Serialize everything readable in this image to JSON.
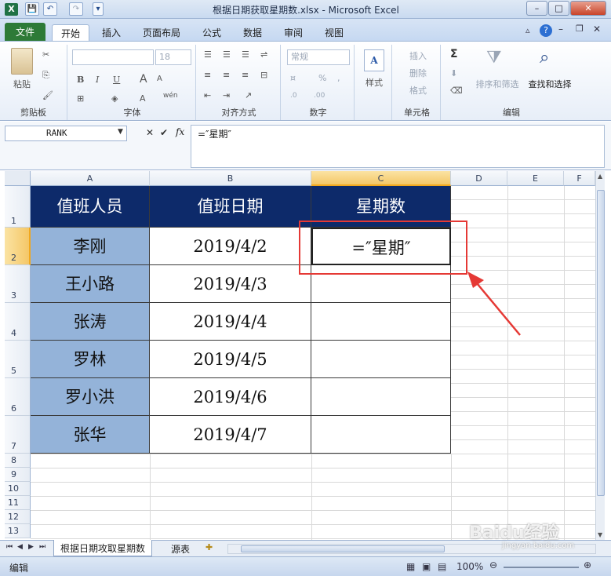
{
  "window": {
    "title": "根据日期获取星期数.xlsx - Microsoft Excel",
    "controls": {
      "minimize": "–",
      "maximize": "□",
      "close": "✕"
    }
  },
  "quick_access": {
    "save": "💾",
    "undo": "↶",
    "redo": "↷",
    "customize": "▾"
  },
  "tabs": [
    "文件",
    "开始",
    "插入",
    "页面布局",
    "公式",
    "数据",
    "审阅",
    "视图"
  ],
  "ribbon": {
    "clipboard": {
      "paste": "粘贴",
      "label": "剪贴板"
    },
    "font": {
      "size": "18",
      "bold": "B",
      "italic": "I",
      "underline": "U",
      "grow": "A",
      "shrink": "A",
      "label": "字体",
      "fontcolor": "A",
      "pinyin": "wén"
    },
    "alignment": {
      "label": "对齐方式"
    },
    "number": {
      "format": "常规",
      "percent": "%",
      "comma": ",",
      "label": "数字"
    },
    "styles": {
      "label": "样式"
    },
    "cells": {
      "insert": "插入",
      "delete": "删除",
      "format": "格式",
      "label": "单元格"
    },
    "editing": {
      "sum": "Σ",
      "sort_filter": "排序和筛选",
      "find_select": "查找和选择",
      "label": "编辑"
    }
  },
  "formula_bar": {
    "name_box": "RANK",
    "fx": "fx",
    "cancel": "✕",
    "enter": "✔",
    "content": "=″星期″"
  },
  "columns": [
    "A",
    "B",
    "C",
    "D",
    "E",
    "F"
  ],
  "rows": [
    "1",
    "2",
    "3",
    "4",
    "5",
    "6",
    "7",
    "8",
    "9",
    "10",
    "11",
    "12",
    "13"
  ],
  "table": {
    "headers": [
      "值班人员",
      "值班日期",
      "星期数"
    ],
    "rows": [
      {
        "name": "李刚",
        "date": "2019/4/2",
        "weekday": "=″星期″"
      },
      {
        "name": "王小路",
        "date": "2019/4/3",
        "weekday": ""
      },
      {
        "name": "张涛",
        "date": "2019/4/4",
        "weekday": ""
      },
      {
        "name": "罗林",
        "date": "2019/4/5",
        "weekday": ""
      },
      {
        "name": "罗小洪",
        "date": "2019/4/6",
        "weekday": ""
      },
      {
        "name": "张华",
        "date": "2019/4/7",
        "weekday": ""
      }
    ]
  },
  "sheets": {
    "active": "根据日期攻取星期数",
    "other": "源表"
  },
  "status": {
    "mode": "编辑",
    "zoom": "100%"
  },
  "watermark": "Baidu经验",
  "watermark_url": "jingyan.baidu.com",
  "colors": {
    "header_fill": "#0d2a6a",
    "name_fill": "#94b3d9",
    "highlight": "#e53935"
  }
}
